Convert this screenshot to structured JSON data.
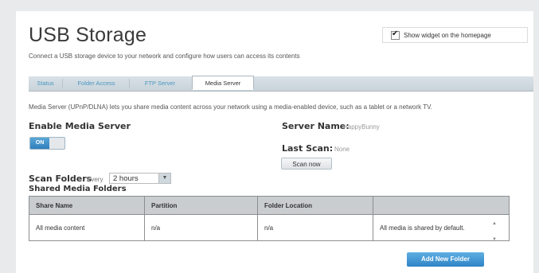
{
  "page": {
    "title": "USB Storage",
    "subtitle": "Connect a USB storage device to your network and configure how users can access its contents"
  },
  "widget": {
    "checked": true,
    "label": "Show widget on the homepage"
  },
  "tabs": [
    {
      "label": "Status",
      "active": false
    },
    {
      "label": "Folder Access",
      "active": false
    },
    {
      "label": "FTP Server",
      "active": false
    },
    {
      "label": "Media Server",
      "active": true
    }
  ],
  "media_server": {
    "description": "Media Server (UPnP/DLNA) lets you share media content across your network using a media-enabled device, such as a tablet or a network TV.",
    "enable_label": "Enable Media Server",
    "toggle_on": "ON",
    "scan_folders_label": "Scan Folders",
    "scan_every_label": "Every",
    "scan_interval": "2 hours",
    "server_name_label": "Server Name:",
    "server_name_value": "HappyBunny",
    "last_scan_label": "Last Scan:",
    "last_scan_value": "None",
    "scan_now_label": "Scan now"
  },
  "shared_folders": {
    "title": "Shared Media Folders",
    "columns": [
      "Share Name",
      "Partition",
      "Folder Location",
      ""
    ],
    "rows": [
      [
        "All media content",
        "n/a",
        "n/a",
        "All media is shared by default."
      ]
    ],
    "add_button": "Add New Folder"
  },
  "colors": {
    "accent": "#2e84c6",
    "tab_link": "#4a97c0",
    "table_header": "#c9cdd0"
  }
}
